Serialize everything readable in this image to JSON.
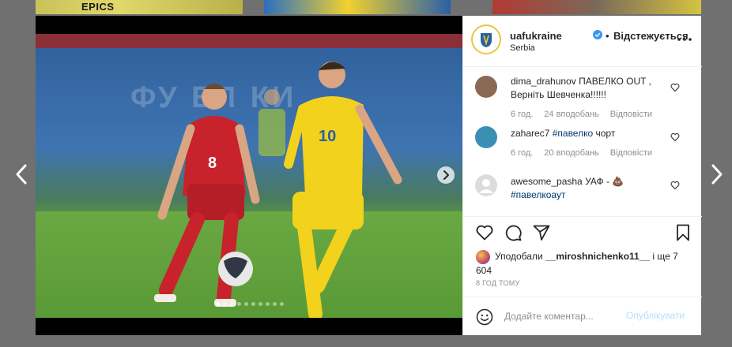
{
  "background": {
    "thumb1_text": "EPICS"
  },
  "post": {
    "username": "uafukraine",
    "follow_separator": "•",
    "follow_status": "Відстежується",
    "location": "Serbia",
    "photo": {
      "shirt_left": "8",
      "shirt_right": "10",
      "billboard": "ФУ ЕЛ КИ",
      "carousel_count": 10,
      "carousel_active_index": 0
    }
  },
  "comments": [
    {
      "user": "dima_drahunov",
      "text": "ПАВЕЛКО OUT , Верніть Шевченка!!!!!!",
      "time": "6 год.",
      "likes": "24 вподобань",
      "reply": "Відповісти",
      "avatar_color": "#8a6a55"
    },
    {
      "user": "zaharec7",
      "tag": "#павелко",
      "text": "чорт",
      "time": "6 год.",
      "likes": "20 вподобань",
      "reply": "Відповісти",
      "avatar_color": "#3a8fb3"
    },
    {
      "user": "awesome_pasha",
      "text": "УАФ -",
      "emoji": "💩",
      "tag": "#павелкоаут",
      "avatar_color": "#dcdcdc"
    }
  ],
  "likes": {
    "prefix": "Уподобали",
    "user": "__miroshnichenko11__",
    "suffix": "і ще 7 604"
  },
  "timestamp": "8 ГОД ТОМУ",
  "add_comment": {
    "placeholder": "Додайте коментар...",
    "publish_label": "Опублікувати"
  },
  "colors": {
    "verified": "#3897f0",
    "hashtag": "#00376b",
    "publish_disabled": "#b2dffc"
  }
}
